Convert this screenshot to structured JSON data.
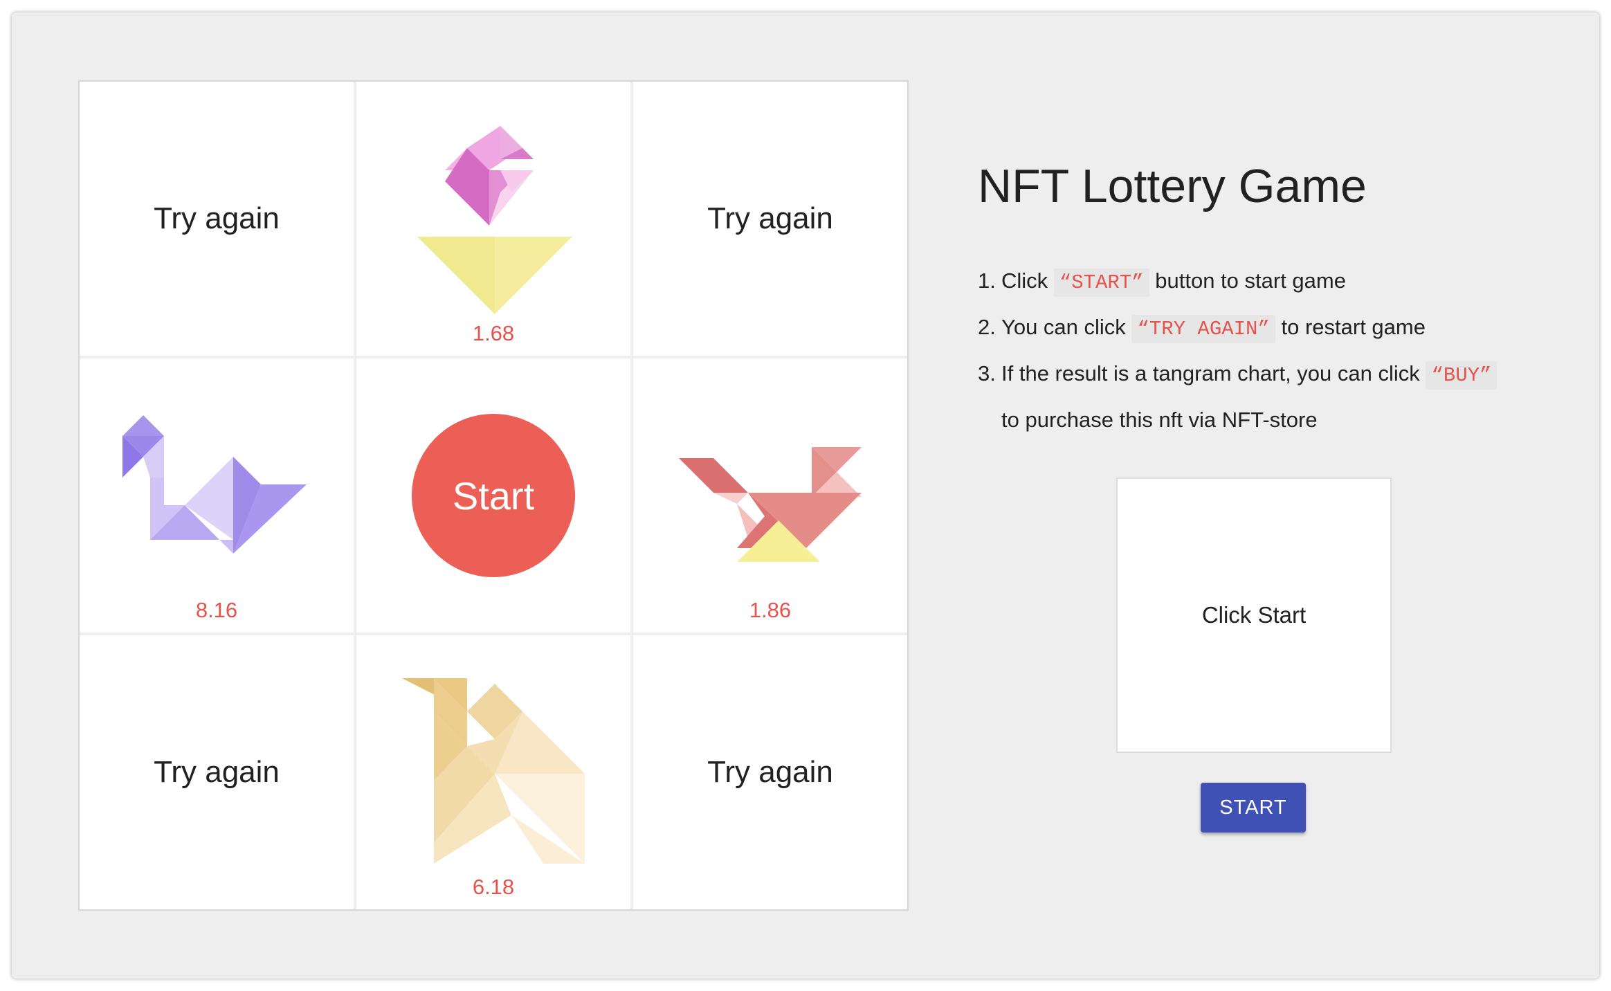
{
  "grid": {
    "cells": [
      {
        "type": "try",
        "label": "Try again"
      },
      {
        "type": "nft",
        "figure": "flower-tangram",
        "price": "1.68"
      },
      {
        "type": "try",
        "label": "Try again"
      },
      {
        "type": "nft",
        "figure": "swan-tangram",
        "price": "8.16"
      },
      {
        "type": "start",
        "label": "Start"
      },
      {
        "type": "nft",
        "figure": "bird-tangram",
        "price": "1.86"
      },
      {
        "type": "try",
        "label": "Try again"
      },
      {
        "type": "nft",
        "figure": "camel-tangram",
        "price": "6.18"
      },
      {
        "type": "try",
        "label": "Try again"
      }
    ]
  },
  "info": {
    "title": "NFT Lottery Game",
    "steps": [
      {
        "num": "1.",
        "before": "Click",
        "keyword": "“START”",
        "after": "button to start game"
      },
      {
        "num": "2.",
        "before": "You can click",
        "keyword": "“TRY AGAIN”",
        "after": "to restart game"
      },
      {
        "num": "3.",
        "before": "If the result is a tangram chart, you can click",
        "keyword": "“BUY”",
        "after": ""
      }
    ],
    "step3_continuation": "to purchase this nft via NFT-store",
    "result_text": "Click Start",
    "start_button_label": "START"
  },
  "colors": {
    "price": "#e5534b",
    "start_circle": "#eb5f56",
    "start_button": "#3f51b5",
    "background": "#eeeeee"
  }
}
